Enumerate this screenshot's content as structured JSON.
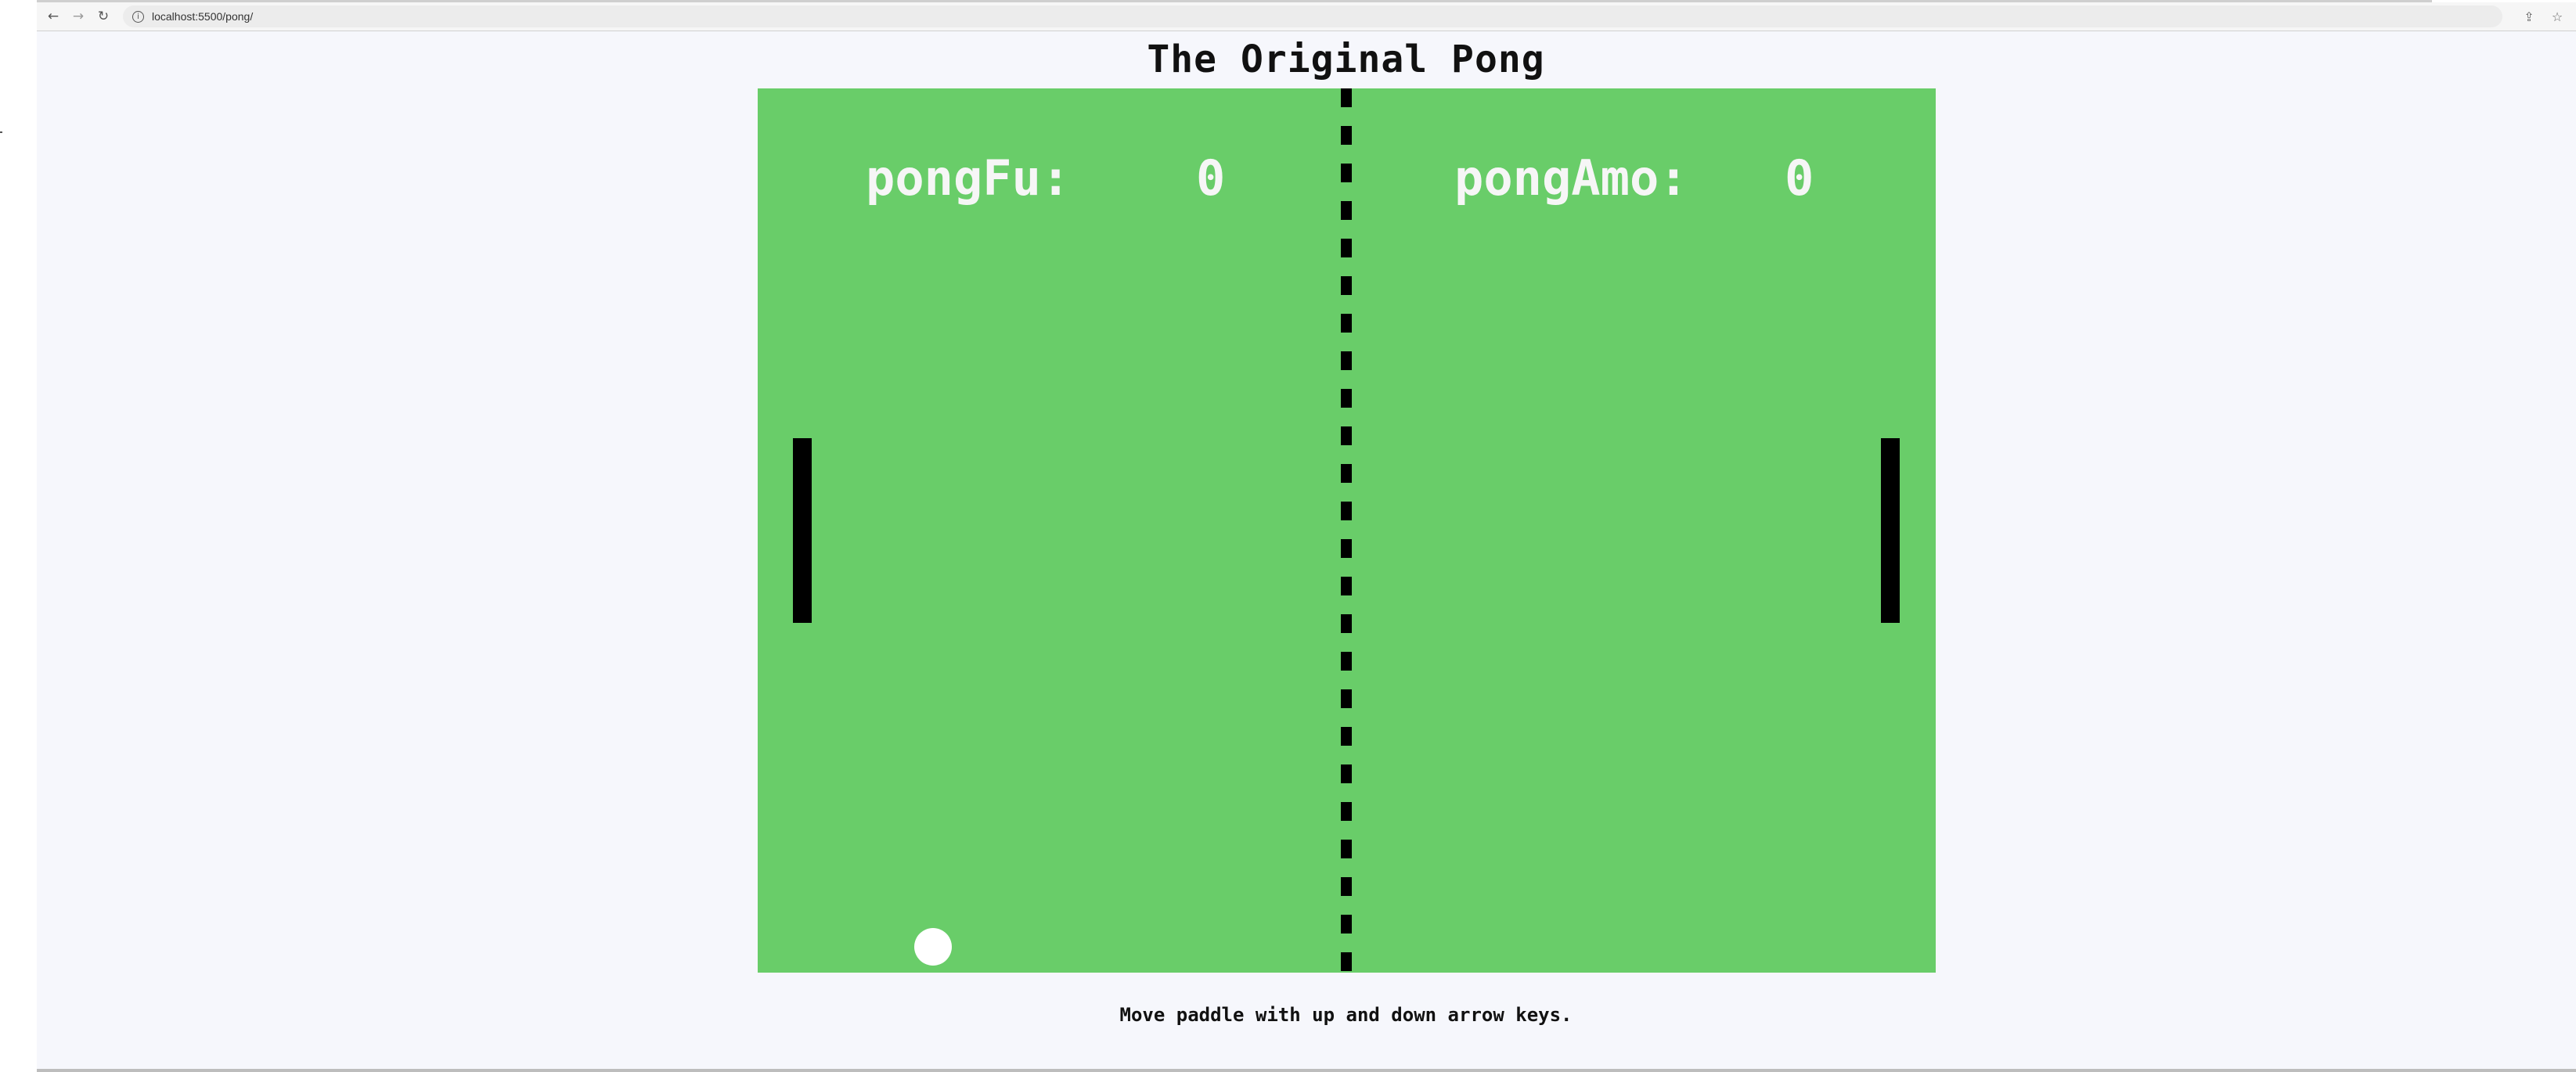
{
  "browser": {
    "url": "localhost:5500/pong/",
    "icons": {
      "back": "arrow-left-icon",
      "forward": "arrow-right-icon",
      "reload": "reload-icon",
      "info": "info-icon",
      "share": "share-icon",
      "star": "star-icon"
    },
    "glyphs": {
      "back": "←",
      "forward": "→",
      "reload": "↻",
      "info": "i",
      "share": "⇪",
      "star": "☆"
    }
  },
  "game": {
    "title": "The Original Pong",
    "players": [
      {
        "name": "pongFu:",
        "score": "0"
      },
      {
        "name": "pongAmo:",
        "score": "0"
      }
    ],
    "instructions": "Move paddle with up and down arrow keys."
  },
  "colors": {
    "court": "#69cd69",
    "paddle": "#000000",
    "ball": "#ffffff",
    "net": "#000000",
    "score_text": "#f6f6f6",
    "page_background": "#f6f7fc"
  }
}
